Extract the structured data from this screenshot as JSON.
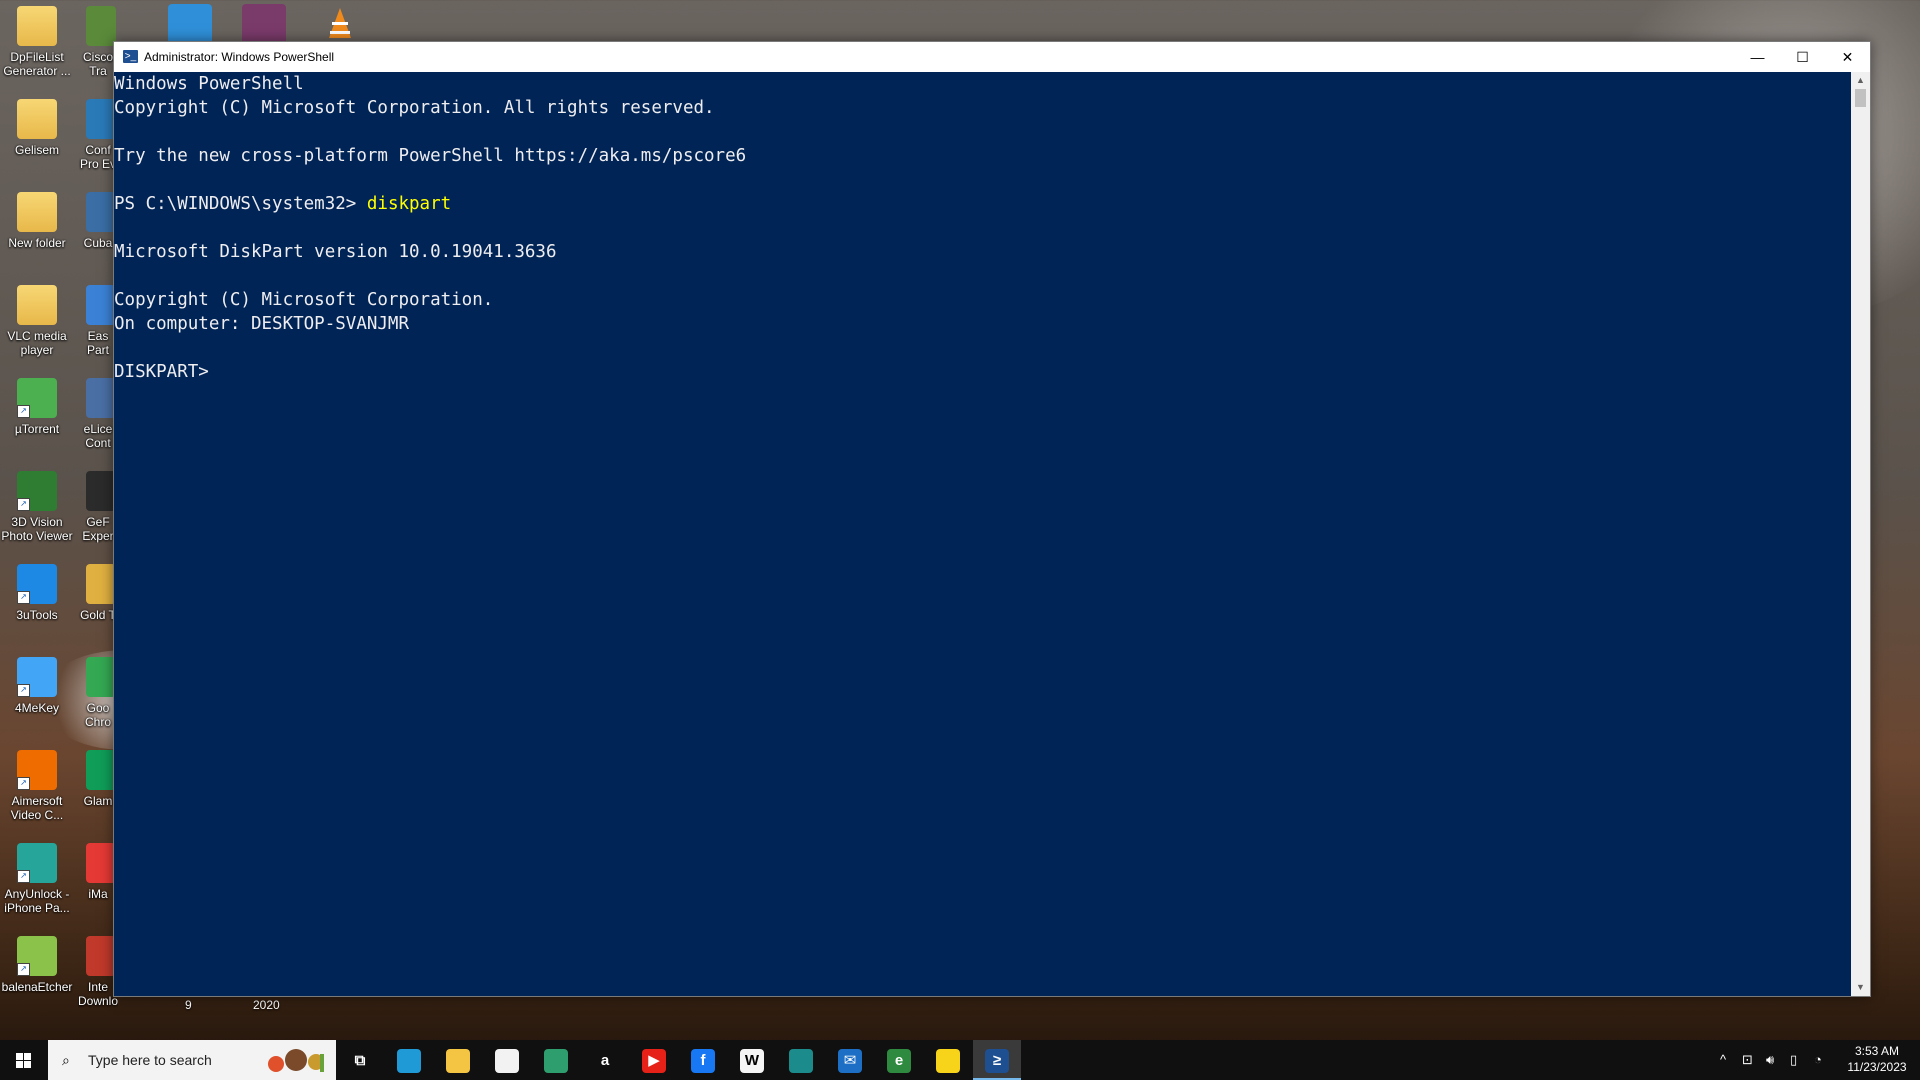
{
  "desktop": {
    "icons_left": [
      {
        "label": "DpFileList Generator ..."
      },
      {
        "label": "Gelisem"
      },
      {
        "label": "New folder"
      },
      {
        "label": "VLC media player"
      },
      {
        "label": "µTorrent"
      },
      {
        "label": "3D Vision Photo Viewer"
      },
      {
        "label": "3uTools"
      },
      {
        "label": "4MeKey"
      },
      {
        "label": "Aimersoft Video C..."
      },
      {
        "label": "AnyUnlock - iPhone Pa..."
      },
      {
        "label": "balenaEtcher"
      }
    ],
    "icons_partial": [
      {
        "label": "Cisco Tra"
      },
      {
        "label": "Conf Pro Ev"
      },
      {
        "label": "Cuba"
      },
      {
        "label": "Eas Part"
      },
      {
        "label": "eLice Cont"
      },
      {
        "label": "GeF Exper"
      },
      {
        "label": "Gold T"
      },
      {
        "label": "Goo Chro"
      },
      {
        "label": "Glam"
      },
      {
        "label": "iMa"
      },
      {
        "label": "Inte Downlo..."
      }
    ],
    "bottom_labels": [
      "9",
      "2020"
    ]
  },
  "window": {
    "title": "Administrator: Windows PowerShell",
    "minimize": "—",
    "maximize": "☐",
    "close": "✕",
    "console_lines": [
      {
        "text": "Windows PowerShell"
      },
      {
        "text": "Copyright (C) Microsoft Corporation. All rights reserved."
      },
      {
        "text": ""
      },
      {
        "text": "Try the new cross-platform PowerShell https://aka.ms/pscore6"
      },
      {
        "text": ""
      },
      {
        "prompt": "PS C:\\WINDOWS\\system32> ",
        "command": "diskpart"
      },
      {
        "text": ""
      },
      {
        "text": "Microsoft DiskPart version 10.0.19041.3636"
      },
      {
        "text": ""
      },
      {
        "text": "Copyright (C) Microsoft Corporation."
      },
      {
        "text": "On computer: DESKTOP-SVANJMR"
      },
      {
        "text": ""
      },
      {
        "text": "DISKPART> "
      }
    ]
  },
  "taskbar": {
    "search_placeholder": "Type here to search",
    "clock_time": "3:53 AM",
    "clock_date": "11/23/2023",
    "apps": [
      {
        "name": "task-view-button",
        "glyph": "⧉",
        "color": "#101010"
      },
      {
        "name": "edge-app",
        "glyph": "",
        "color": "#1f9ad6"
      },
      {
        "name": "file-explorer-app",
        "glyph": "",
        "color": "#f4c542"
      },
      {
        "name": "store-app",
        "glyph": "",
        "color": "#f2f2f2"
      },
      {
        "name": "edge-dev-app",
        "glyph": "",
        "color": "#2f9e6e"
      },
      {
        "name": "amazon-app",
        "glyph": "a",
        "color": "#101010"
      },
      {
        "name": "youtube-app",
        "glyph": "▶",
        "color": "#e62117"
      },
      {
        "name": "facebook-app",
        "glyph": "f",
        "color": "#1877f2"
      },
      {
        "name": "wikipedia-app",
        "glyph": "W",
        "color": "#f5f5f5"
      },
      {
        "name": "edge-beta-app",
        "glyph": "",
        "color": "#1c8b8b"
      },
      {
        "name": "mail-app",
        "glyph": "✉",
        "color": "#1d6fc6"
      },
      {
        "name": "ie-app",
        "glyph": "e",
        "color": "#2d8a3e"
      },
      {
        "name": "sticky-notes-app",
        "glyph": "",
        "color": "#f7d31a"
      },
      {
        "name": "powershell-app",
        "glyph": "≥",
        "color": "#1d4f91"
      }
    ]
  },
  "colors": {
    "console_bg": "#012456",
    "console_fg": "#eeedf0",
    "command_fg": "#ffff00"
  }
}
